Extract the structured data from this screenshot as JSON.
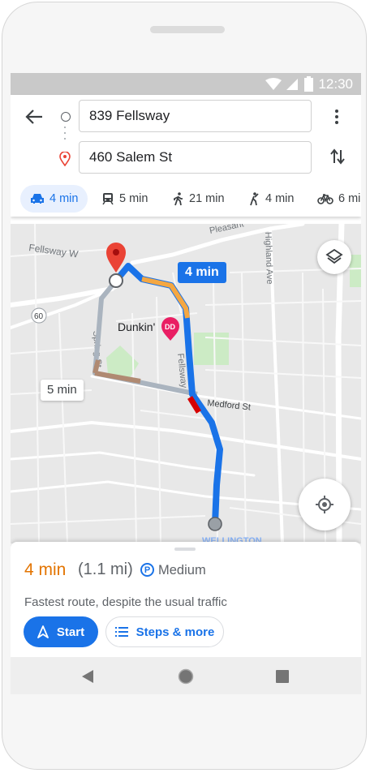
{
  "status_bar": {
    "time": "12:30"
  },
  "directions": {
    "origin": "839 Fellsway",
    "destination": "460 Salem St"
  },
  "modes": [
    {
      "icon": "car-icon",
      "label": "4 min",
      "selected": true
    },
    {
      "icon": "transit-icon",
      "label": "5 min",
      "selected": false
    },
    {
      "icon": "walk-icon",
      "label": "21 min",
      "selected": false
    },
    {
      "icon": "rideshare-icon",
      "label": "4 min",
      "selected": false
    },
    {
      "icon": "bike-icon",
      "label": "6 mi",
      "selected": false
    }
  ],
  "map": {
    "streets": [
      "Pleasant",
      "Fellsway W",
      "Highland Ave",
      "Spring St",
      "Fellsway",
      "Medford St",
      "WELLINGTON"
    ],
    "route_number": "60",
    "poi_label": "Dunkin'",
    "poi_badge": "DD",
    "selected_route_chip": "4 min",
    "alternate_route_chip": "5 min"
  },
  "route_summary": {
    "duration": "4 min",
    "distance": "(1.1 mi)",
    "parking_icon": "P",
    "parking_label": "Medium",
    "description": "Fastest route, despite the usual traffic",
    "start_label": "Start",
    "steps_label": "Steps & more"
  },
  "colors": {
    "accent_blue": "#1a73e8",
    "duration_orange": "#e37400",
    "traffic_orange": "#f4a742",
    "traffic_red": "#d50000",
    "pin_red": "#ea4335",
    "poi_pink": "#e91e63"
  }
}
